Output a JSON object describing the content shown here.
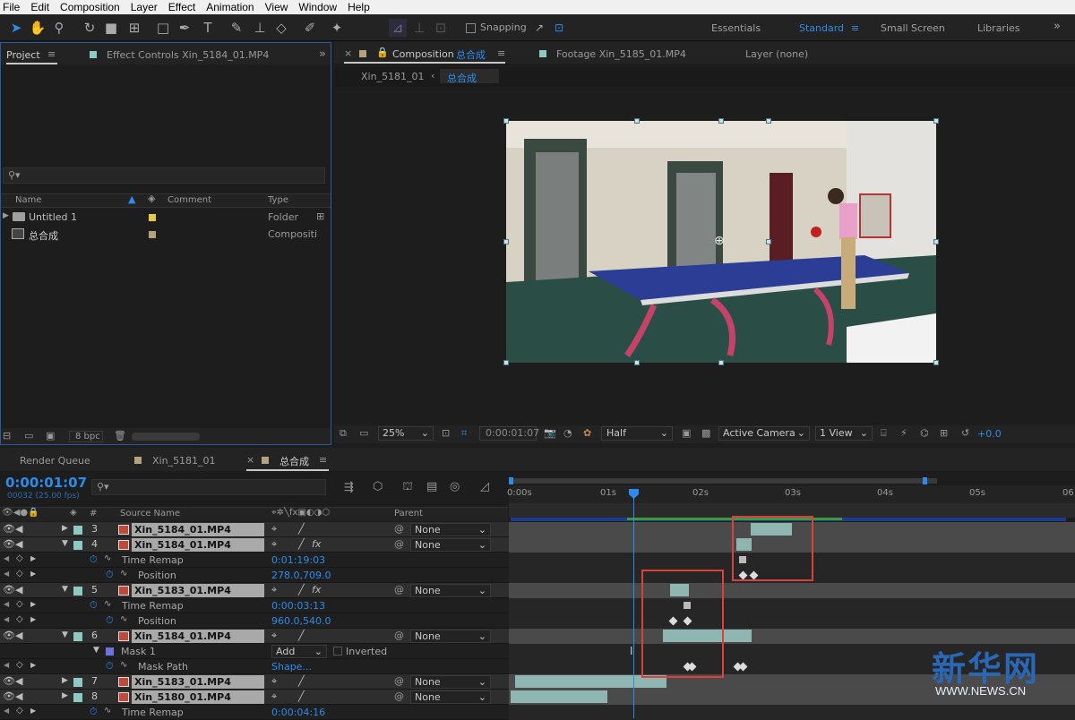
{
  "menu": [
    "File",
    "Edit",
    "Composition",
    "Layer",
    "Effect",
    "Animation",
    "View",
    "Window",
    "Help"
  ],
  "toolbar": {
    "snapping_label": "Snapping"
  },
  "workspaces": {
    "essentials": "Essentials",
    "standard": "Standard",
    "small_screen": "Small Screen",
    "libraries": "Libraries"
  },
  "project": {
    "tab_project": "Project",
    "tab_effect_controls": "Effect Controls Xin_5184_01.MP4",
    "columns": {
      "name": "Name",
      "comment": "Comment",
      "type": "Type"
    },
    "items": [
      {
        "name": "Untitled 1",
        "type": "Folder",
        "color": "#e6c84a"
      },
      {
        "name": "总合成",
        "type": "Compositi",
        "color": "#b3a27a"
      }
    ],
    "bpc": "8 bpc"
  },
  "viewer": {
    "tab_composition_prefix": "Composition",
    "tab_composition_name": "总合成",
    "tab_footage": "Footage Xin_5185_01.MP4",
    "tab_layer": "Layer (none)",
    "crumb_1": "Xin_5181_01",
    "crumb_2": "总合成",
    "zoom": "25%",
    "timecode": "0:00:01:07",
    "resolution": "Half",
    "camera": "Active Camera",
    "views": "1 View",
    "exposure": "+0.0"
  },
  "timeline": {
    "tab_render_queue": "Render Queue",
    "tab_comp1": "Xin_5181_01",
    "tab_comp2": "总合成",
    "current_time": "0:00:01:07",
    "frame_info": "00032 (25.00 fps)",
    "col_source": "Source Name",
    "col_parent": "Parent",
    "col_hash": "#",
    "ruler": [
      "0:00s",
      "01s",
      "02s",
      "03s",
      "04s",
      "05s",
      "06"
    ],
    "rows": [
      {
        "kind": "layer",
        "num": "3",
        "name": "Xin_5184_01.MP4",
        "parent": "None",
        "expanded": false,
        "fx": false
      },
      {
        "kind": "layer",
        "num": "4",
        "name": "Xin_5184_01.MP4",
        "parent": "None",
        "expanded": true,
        "fx": true
      },
      {
        "kind": "prop",
        "label": "Time Remap",
        "value": "0:01:19:03"
      },
      {
        "kind": "prop",
        "label": "Position",
        "value": "278.0,709.0"
      },
      {
        "kind": "layer",
        "num": "5",
        "name": "Xin_5183_01.MP4",
        "parent": "None",
        "expanded": true,
        "fx": true
      },
      {
        "kind": "prop",
        "label": "Time Remap",
        "value": "0:00:03:13"
      },
      {
        "kind": "prop",
        "label": "Position",
        "value": "960.0,540.0"
      },
      {
        "kind": "layer",
        "num": "6",
        "name": "Xin_5184_01.MP4",
        "parent": "None",
        "expanded": true,
        "fx": false
      },
      {
        "kind": "mask",
        "label": "Mask 1",
        "mode": "Add",
        "inverted": "Inverted"
      },
      {
        "kind": "prop",
        "label": "Mask Path",
        "value": "Shape..."
      },
      {
        "kind": "layer",
        "num": "7",
        "name": "Xin_5183_01.MP4",
        "parent": "None",
        "expanded": false,
        "fx": false
      },
      {
        "kind": "layer",
        "num": "8",
        "name": "Xin_5180_01.MP4",
        "parent": "None",
        "expanded": false,
        "fx": false
      },
      {
        "kind": "prop",
        "label": "Time Remap",
        "value": "0:00:04:16"
      }
    ]
  },
  "watermark": {
    "logo": "新华网",
    "url": "WWW.NEWS.CN"
  },
  "colors": {
    "accent": "#2d8ceb",
    "highlight_box": "#d9403e",
    "clip": "#8fb6b1"
  }
}
